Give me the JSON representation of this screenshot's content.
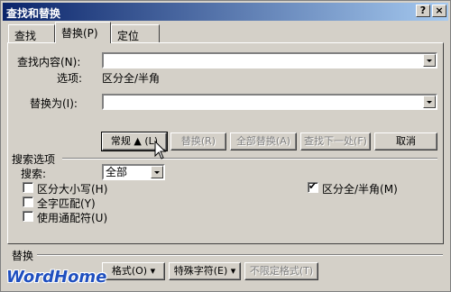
{
  "window": {
    "title": "查找和替换",
    "help_label": "?",
    "close_label": "×"
  },
  "tabs": [
    {
      "label": "查找(D)"
    },
    {
      "label": "替换(P)"
    },
    {
      "label": "定位(G)"
    }
  ],
  "find": {
    "label": "查找内容(N):",
    "value": "",
    "options_prefix": "选项:",
    "options_value": "区分全/半角"
  },
  "replace": {
    "label": "替换为(I):",
    "value": ""
  },
  "buttons": {
    "normal": "常规 ▲ (L)",
    "replace": "替换(R)",
    "replace_all": "全部替换(A)",
    "find_next": "查找下一处(F)",
    "cancel": "取消"
  },
  "search_options": {
    "heading": "搜索选项",
    "search_label": "搜索:",
    "search_value": "全部",
    "match_case": {
      "label": "区分大小写(H)",
      "checked": false
    },
    "whole_word": {
      "label": "全字匹配(Y)",
      "checked": false
    },
    "wildcards": {
      "label": "使用通配符(U)",
      "checked": false
    },
    "width_sensitive": {
      "label": "区分全/半角(M)",
      "checked": true
    }
  },
  "replace_section": {
    "heading": "替换",
    "format": "格式(O) ▾",
    "special": "特殊字符(E) ▾",
    "no_format": "不限定格式(T)"
  },
  "watermark": "WordHome"
}
